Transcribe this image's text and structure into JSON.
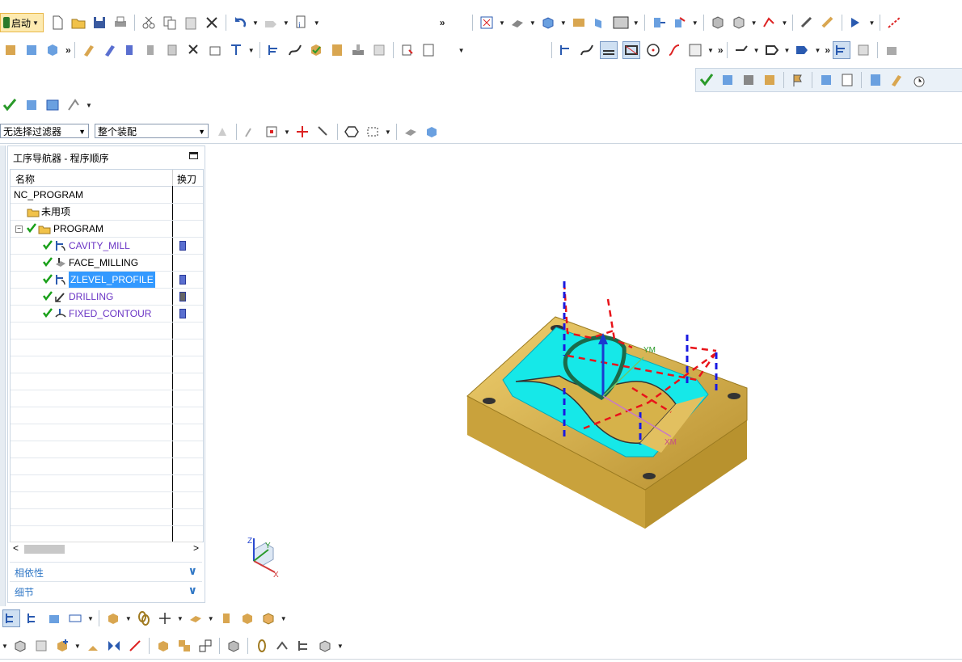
{
  "toolbar_row1": {
    "start_label": "启动",
    "overflow": "»"
  },
  "selection": {
    "filter_value": "无选择过滤器",
    "scope_value": "整个装配"
  },
  "navigator": {
    "title": "工序导航器 - 程序顺序",
    "columns": {
      "name": "名称",
      "tool_change": "换刀"
    },
    "rows": [
      {
        "label": "NC_PROGRAM",
        "kind": "root"
      },
      {
        "label": "未用项",
        "kind": "folder"
      },
      {
        "label": "PROGRAM",
        "kind": "program"
      },
      {
        "label": "CAVITY_MILL",
        "kind": "operation",
        "tool": true
      },
      {
        "label": "FACE_MILLING",
        "kind": "operation",
        "tool": false
      },
      {
        "label": "ZLEVEL_PROFILE",
        "kind": "operation",
        "tool": true,
        "selected": true
      },
      {
        "label": "DRILLING",
        "kind": "operation",
        "tool": "drill"
      },
      {
        "label": "FIXED_CONTOUR",
        "kind": "operation",
        "tool": true
      }
    ],
    "sections": [
      {
        "label": "相依性"
      },
      {
        "label": "细节"
      }
    ],
    "scroll_left": "<",
    "scroll_right": ">"
  },
  "viewport": {
    "wcs_labels": {
      "ym": "YM",
      "xm": "XM"
    },
    "triad_labels": {
      "x": "X",
      "y": "Y",
      "z": "Z"
    }
  },
  "colors": {
    "toolbar_bg": "#eaf1f8",
    "selection_blue": "#3399ff",
    "operation_purple": "#6b35c5",
    "part_gold": "#d6b24a",
    "cavity_cyan": "#16e8e8",
    "toolpath_red": "#e8141a",
    "toolpath_blue": "#1a1ae0",
    "section_blue": "#3178c6"
  }
}
